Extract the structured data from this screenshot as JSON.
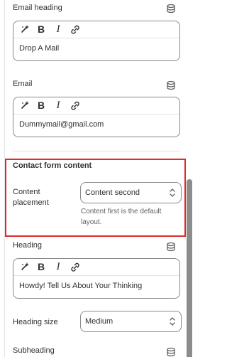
{
  "fields": {
    "email_heading": {
      "label": "Email heading",
      "value": "Drop A Mail"
    },
    "email": {
      "label": "Email",
      "value": "Dummymail@gmail.com"
    },
    "heading": {
      "label": "Heading",
      "value": "Howdy! Tell Us About Your Thinking"
    },
    "subheading": {
      "label": "Subheading"
    }
  },
  "toolbar": {
    "bold": "B",
    "italic": "I"
  },
  "contact_section": {
    "title": "Contact form content",
    "placement_label_line1": "Content",
    "placement_label_line2": "placement",
    "placement_value": "Content second",
    "help_line1": "Content first is the default",
    "help_line2": "layout."
  },
  "heading_size": {
    "label": "Heading size",
    "value": "Medium"
  },
  "icons": {
    "dynamic_source": "database-icon",
    "magic": "sparkle-icon",
    "link": "link-icon",
    "select_arrow": "chevron-updown-icon"
  },
  "colors": {
    "highlight_border": "#e02a2a",
    "border": "#8a8a8a",
    "text": "#303030",
    "muted": "#616161"
  }
}
